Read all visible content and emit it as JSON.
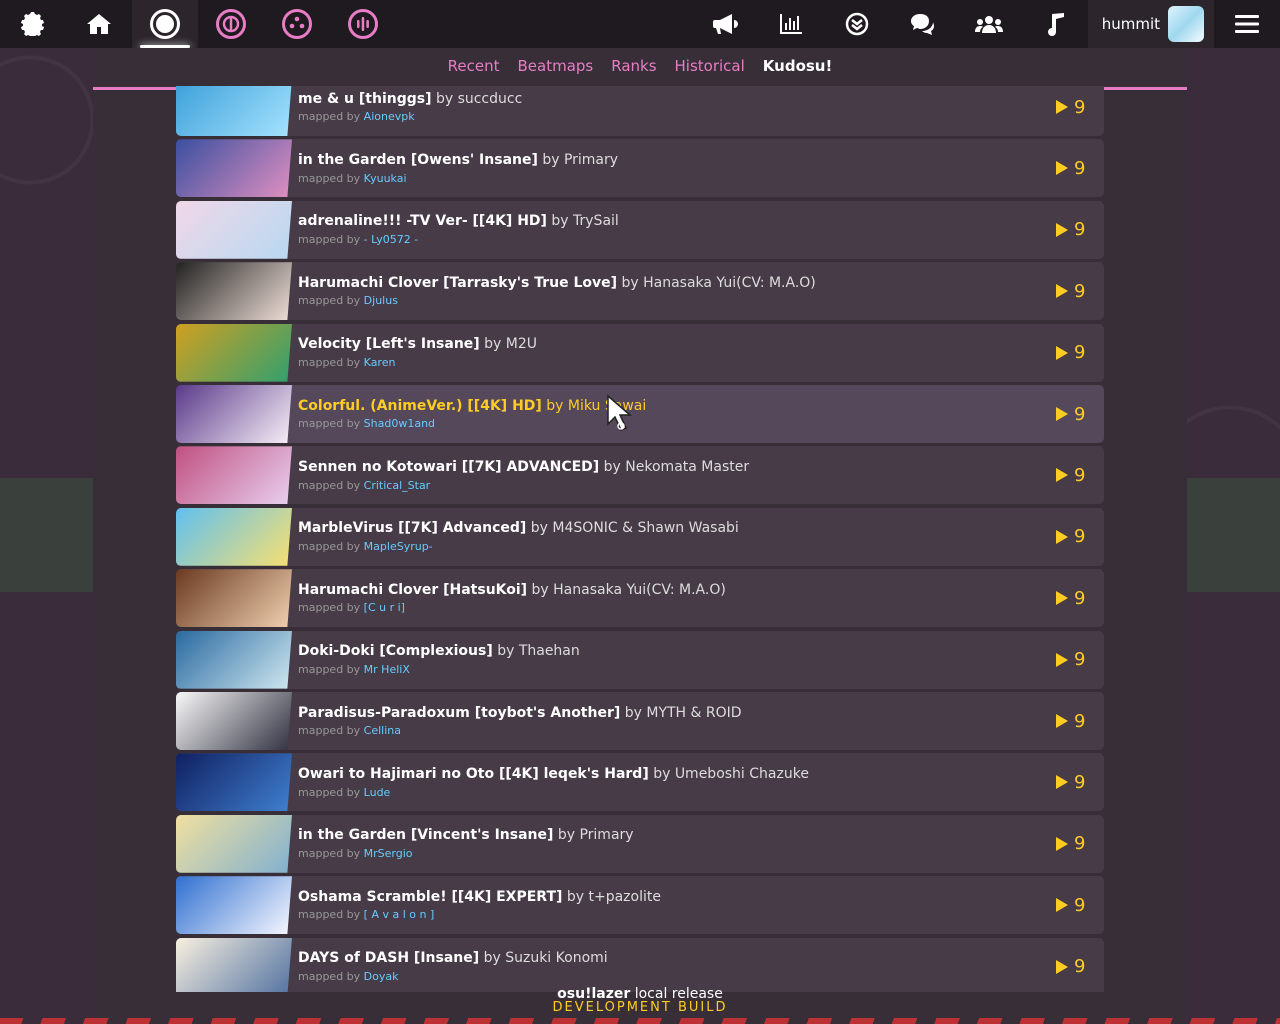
{
  "toolbar": {
    "icons": [
      "settings-icon",
      "home-icon",
      "osu-ruleset-icon",
      "taiko-ruleset-icon",
      "catch-ruleset-icon",
      "mania-ruleset-icon",
      "news-icon",
      "rankings-icon",
      "beatmap-listing-icon",
      "chat-icon",
      "social-icon",
      "music-icon",
      "menu-icon"
    ],
    "username": "hummit"
  },
  "tabs": [
    {
      "label": "Recent",
      "active": false
    },
    {
      "label": "Beatmaps",
      "active": false
    },
    {
      "label": "Ranks",
      "active": false
    },
    {
      "label": "Historical",
      "active": false
    },
    {
      "label": "Kudosu!",
      "active": true
    }
  ],
  "mapped_by_label": "mapped by",
  "by_label": "by",
  "rows": [
    {
      "title": "me & u [thinggs]",
      "artist": "succducc",
      "mapper": "Aionevpk",
      "count": "9",
      "colors": [
        "#3a9fd8",
        "#a6e3ff"
      ]
    },
    {
      "title": "in the Garden [Owens' Insane]",
      "artist": "Primary",
      "mapper": "Kyuukai",
      "count": "9",
      "colors": [
        "#3a4fa0",
        "#e090c0"
      ]
    },
    {
      "title": "adrenaline!!! -TV Ver- [[4K] HD]",
      "artist": "TrySail",
      "mapper": "- Ly0572 -",
      "count": "9",
      "colors": [
        "#f0d8e8",
        "#b8d8f0"
      ]
    },
    {
      "title": "Harumachi Clover [Tarrasky's True Love]",
      "artist": "Hanasaka Yui(CV: M.A.O)",
      "mapper": "Djulus",
      "count": "9",
      "colors": [
        "#222",
        "#f0e0d8"
      ]
    },
    {
      "title": "Velocity [Left's Insane]",
      "artist": "M2U",
      "mapper": "Karen",
      "count": "9",
      "colors": [
        "#d0a020",
        "#30a070"
      ]
    },
    {
      "title": "Colorful. (AnimeVer.) [[4K] HD]",
      "artist": "Miku Sawai",
      "mapper": "Shad0w1and",
      "count": "9",
      "colors": [
        "#5a3a8a",
        "#f8f0f8"
      ],
      "hover": true
    },
    {
      "title": "Sennen no Kotowari [[7K] ADVANCED]",
      "artist": "Nekomata Master",
      "mapper": "Critical_Star",
      "count": "9",
      "colors": [
        "#c05080",
        "#e8d0f0"
      ]
    },
    {
      "title": "MarbleVirus [[7K] Advanced]",
      "artist": "M4SONIC & Shawn Wasabi",
      "mapper": "MapleSyrup-",
      "count": "9",
      "colors": [
        "#60c0f0",
        "#f8e070"
      ]
    },
    {
      "title": "Harumachi Clover [HatsuKoi]",
      "artist": "Hanasaka Yui(CV: M.A.O)",
      "mapper": "[C u r i]",
      "count": "9",
      "colors": [
        "#6a3a20",
        "#f0d0b0"
      ]
    },
    {
      "title": "Doki-Doki [Complexious]",
      "artist": "Thaehan",
      "mapper": "Mr HeliX",
      "count": "9",
      "colors": [
        "#2a6aa0",
        "#d0e8f0"
      ]
    },
    {
      "title": "Paradisus-Paradoxum [toybot's Another]",
      "artist": "MYTH & ROID",
      "mapper": "Cellina",
      "count": "9",
      "colors": [
        "#f8f8f8",
        "#303040"
      ]
    },
    {
      "title": "Owari to Hajimari no Oto [[4K] leqek's Hard]",
      "artist": "Umeboshi Chazuke",
      "mapper": "Lude",
      "count": "9",
      "colors": [
        "#102060",
        "#4080d0"
      ]
    },
    {
      "title": "in the Garden [Vincent's Insane]",
      "artist": "Primary",
      "mapper": "MrSergio",
      "count": "9",
      "colors": [
        "#f0e0a0",
        "#80b0d0"
      ]
    },
    {
      "title": "Oshama Scramble! [[4K] EXPERT]",
      "artist": "t+pazolite",
      "mapper": "[ A v a l o n ]",
      "count": "9",
      "colors": [
        "#3070d0",
        "#f8f8ff"
      ]
    },
    {
      "title": "DAYS of DASH [Insane]",
      "artist": "Suzuki Konomi",
      "mapper": "Doyak",
      "count": "9",
      "colors": [
        "#f8f0e0",
        "#5070a0"
      ]
    }
  ],
  "footer": {
    "name": "osu!lazer",
    "release": "local release",
    "build": "DEVELOPMENT BUILD"
  }
}
